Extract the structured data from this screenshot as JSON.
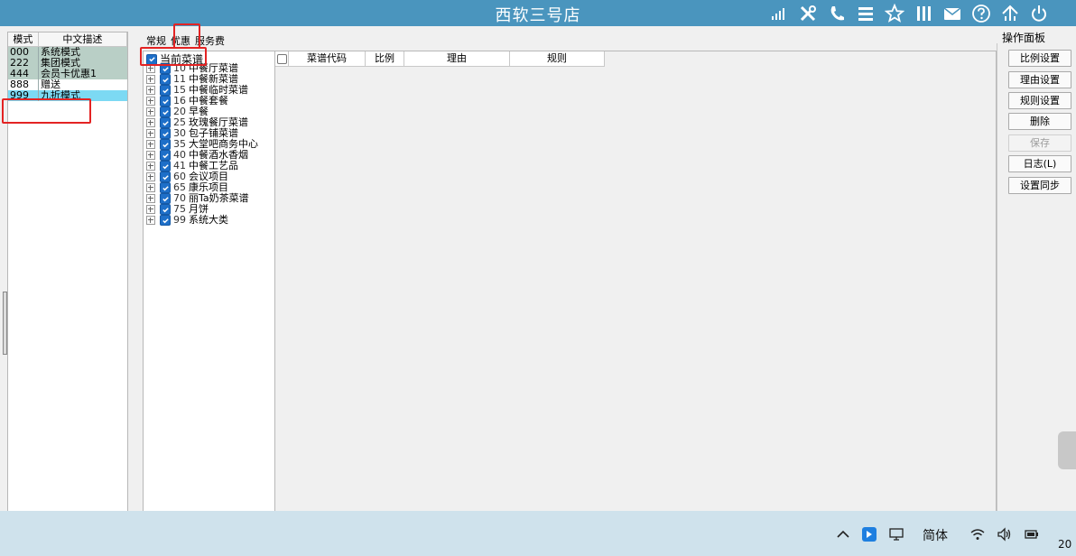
{
  "window": {
    "title": "西软三号店"
  },
  "titlebar_icons": [
    "signal-icon",
    "tools-icon",
    "phone-icon",
    "menu-icon",
    "star-icon",
    "columns-icon",
    "mail-icon",
    "help-icon",
    "network-icon",
    "power-icon"
  ],
  "modes": {
    "headers": [
      "模式",
      "中文描述"
    ],
    "rows": [
      {
        "code": "000",
        "desc": "系统模式"
      },
      {
        "code": "222",
        "desc": "集团模式"
      },
      {
        "code": "444",
        "desc": "会员卡优惠1"
      },
      {
        "code": "888",
        "desc": "赠送"
      },
      {
        "code": "999",
        "desc": "九折模式"
      }
    ]
  },
  "tabs": [
    "常规",
    "优惠",
    "服务费"
  ],
  "tree": {
    "root": "当前菜谱",
    "items": [
      {
        "code": "10",
        "name": "中餐厅菜谱"
      },
      {
        "code": "11",
        "name": "中餐新菜谱"
      },
      {
        "code": "15",
        "name": "中餐临时菜谱"
      },
      {
        "code": "16",
        "name": "中餐套餐"
      },
      {
        "code": "20",
        "name": "早餐"
      },
      {
        "code": "25",
        "name": "玫瑰餐厅菜谱"
      },
      {
        "code": "30",
        "name": "包子铺菜谱"
      },
      {
        "code": "35",
        "name": "大堂吧商务中心"
      },
      {
        "code": "40",
        "name": "中餐酒水香烟"
      },
      {
        "code": "41",
        "name": "中餐工艺品"
      },
      {
        "code": "60",
        "name": "会议项目"
      },
      {
        "code": "65",
        "name": "康乐项目"
      },
      {
        "code": "70",
        "name": "丽Ta奶茶菜谱"
      },
      {
        "code": "75",
        "name": "月饼"
      },
      {
        "code": "99",
        "name": "系统大类"
      }
    ]
  },
  "grid": {
    "columns": [
      "菜谱代码",
      "比例",
      "理由",
      "规则"
    ]
  },
  "ops": {
    "title": "操作面板",
    "buttons": [
      {
        "label": "比例设置",
        "enabled": true
      },
      {
        "label": "理由设置",
        "enabled": true
      },
      {
        "label": "规则设置",
        "enabled": true
      },
      {
        "label": "删除",
        "enabled": true
      },
      {
        "label": "保存",
        "enabled": false
      },
      {
        "label": "日志(L)",
        "enabled": true
      },
      {
        "label": "设置同步",
        "enabled": true
      }
    ]
  },
  "taskbar": {
    "ime": "简体",
    "clock": "20"
  },
  "highlight_color": "#e32323",
  "titlebar_color": "#4a95be"
}
